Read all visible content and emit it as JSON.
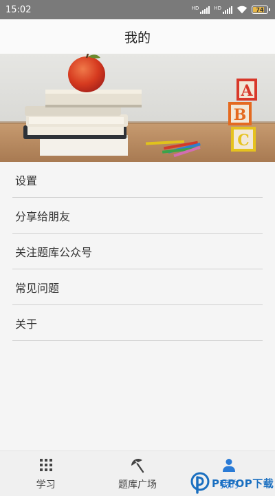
{
  "status_bar": {
    "time": "15:02",
    "battery": "74",
    "network_label_1": "HD",
    "network_label_2": "HD"
  },
  "header": {
    "title": "我的"
  },
  "banner": {
    "block_letters": [
      "A",
      "B",
      "C"
    ],
    "colors": {
      "wall": "#dcdcd8",
      "table": "#b98a5e",
      "apple": "#d93b22",
      "book_cover": "#ece6d6"
    }
  },
  "menu": {
    "items": [
      {
        "label": "设置"
      },
      {
        "label": "分享给朋友"
      },
      {
        "label": "关注题库公众号"
      },
      {
        "label": "常见问题"
      },
      {
        "label": "关于"
      }
    ]
  },
  "bottom_nav": {
    "tabs": [
      {
        "label": "学习",
        "icon": "grid-icon",
        "active": false
      },
      {
        "label": "题库广场",
        "icon": "umbrella-icon",
        "active": false
      },
      {
        "label": "我的",
        "icon": "person-icon",
        "active": true
      }
    ],
    "accent_color": "#2a7bd6"
  },
  "watermark": {
    "text": "PCPOP下载"
  }
}
